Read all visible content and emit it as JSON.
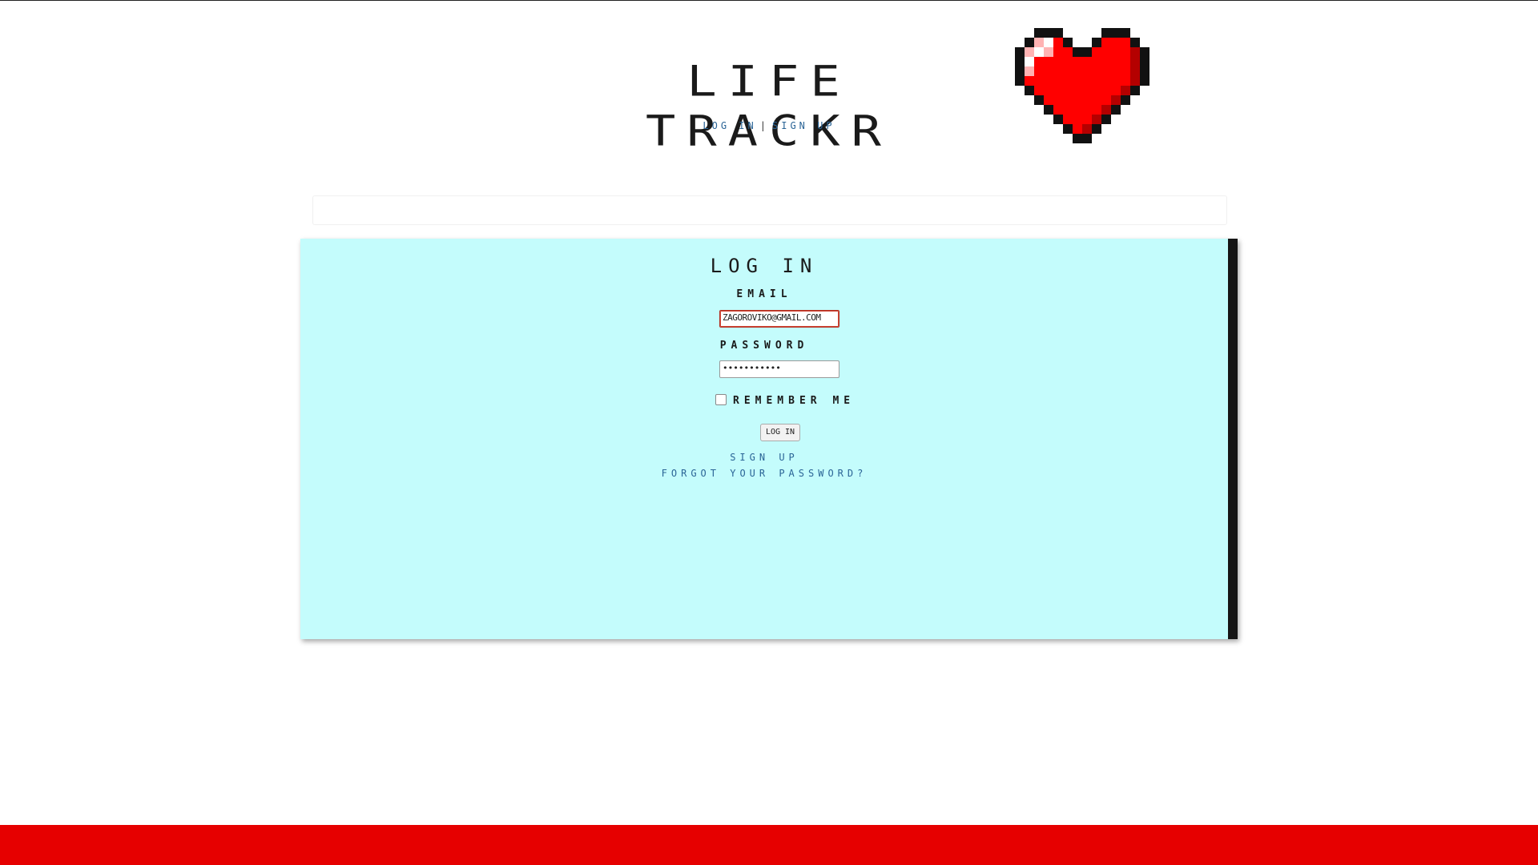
{
  "app": {
    "title": "LIFE TRACKR"
  },
  "top_nav": {
    "login_link": "LOG IN",
    "separator": "|",
    "signup_link": "SIGN UP"
  },
  "login_form": {
    "heading": "LOG IN",
    "email_label": "EMAIL",
    "email_value": "ZAGOROVIKO@GMAIL.COM",
    "password_label": "PASSWORD",
    "password_value": "•••••••••••",
    "remember_label": "REMEMBER ME",
    "remember_checked": false,
    "submit_label": "LOG IN",
    "signup_link": "SIGN UP",
    "forgot_link": "FORGOT YOUR PASSWORD?"
  },
  "colors": {
    "panel_bg": "#c4fcfc",
    "footer": "#e60000",
    "link": "#2a6496",
    "heart": "#ff0000"
  },
  "icons": {
    "logo": "pixel-heart-icon"
  }
}
